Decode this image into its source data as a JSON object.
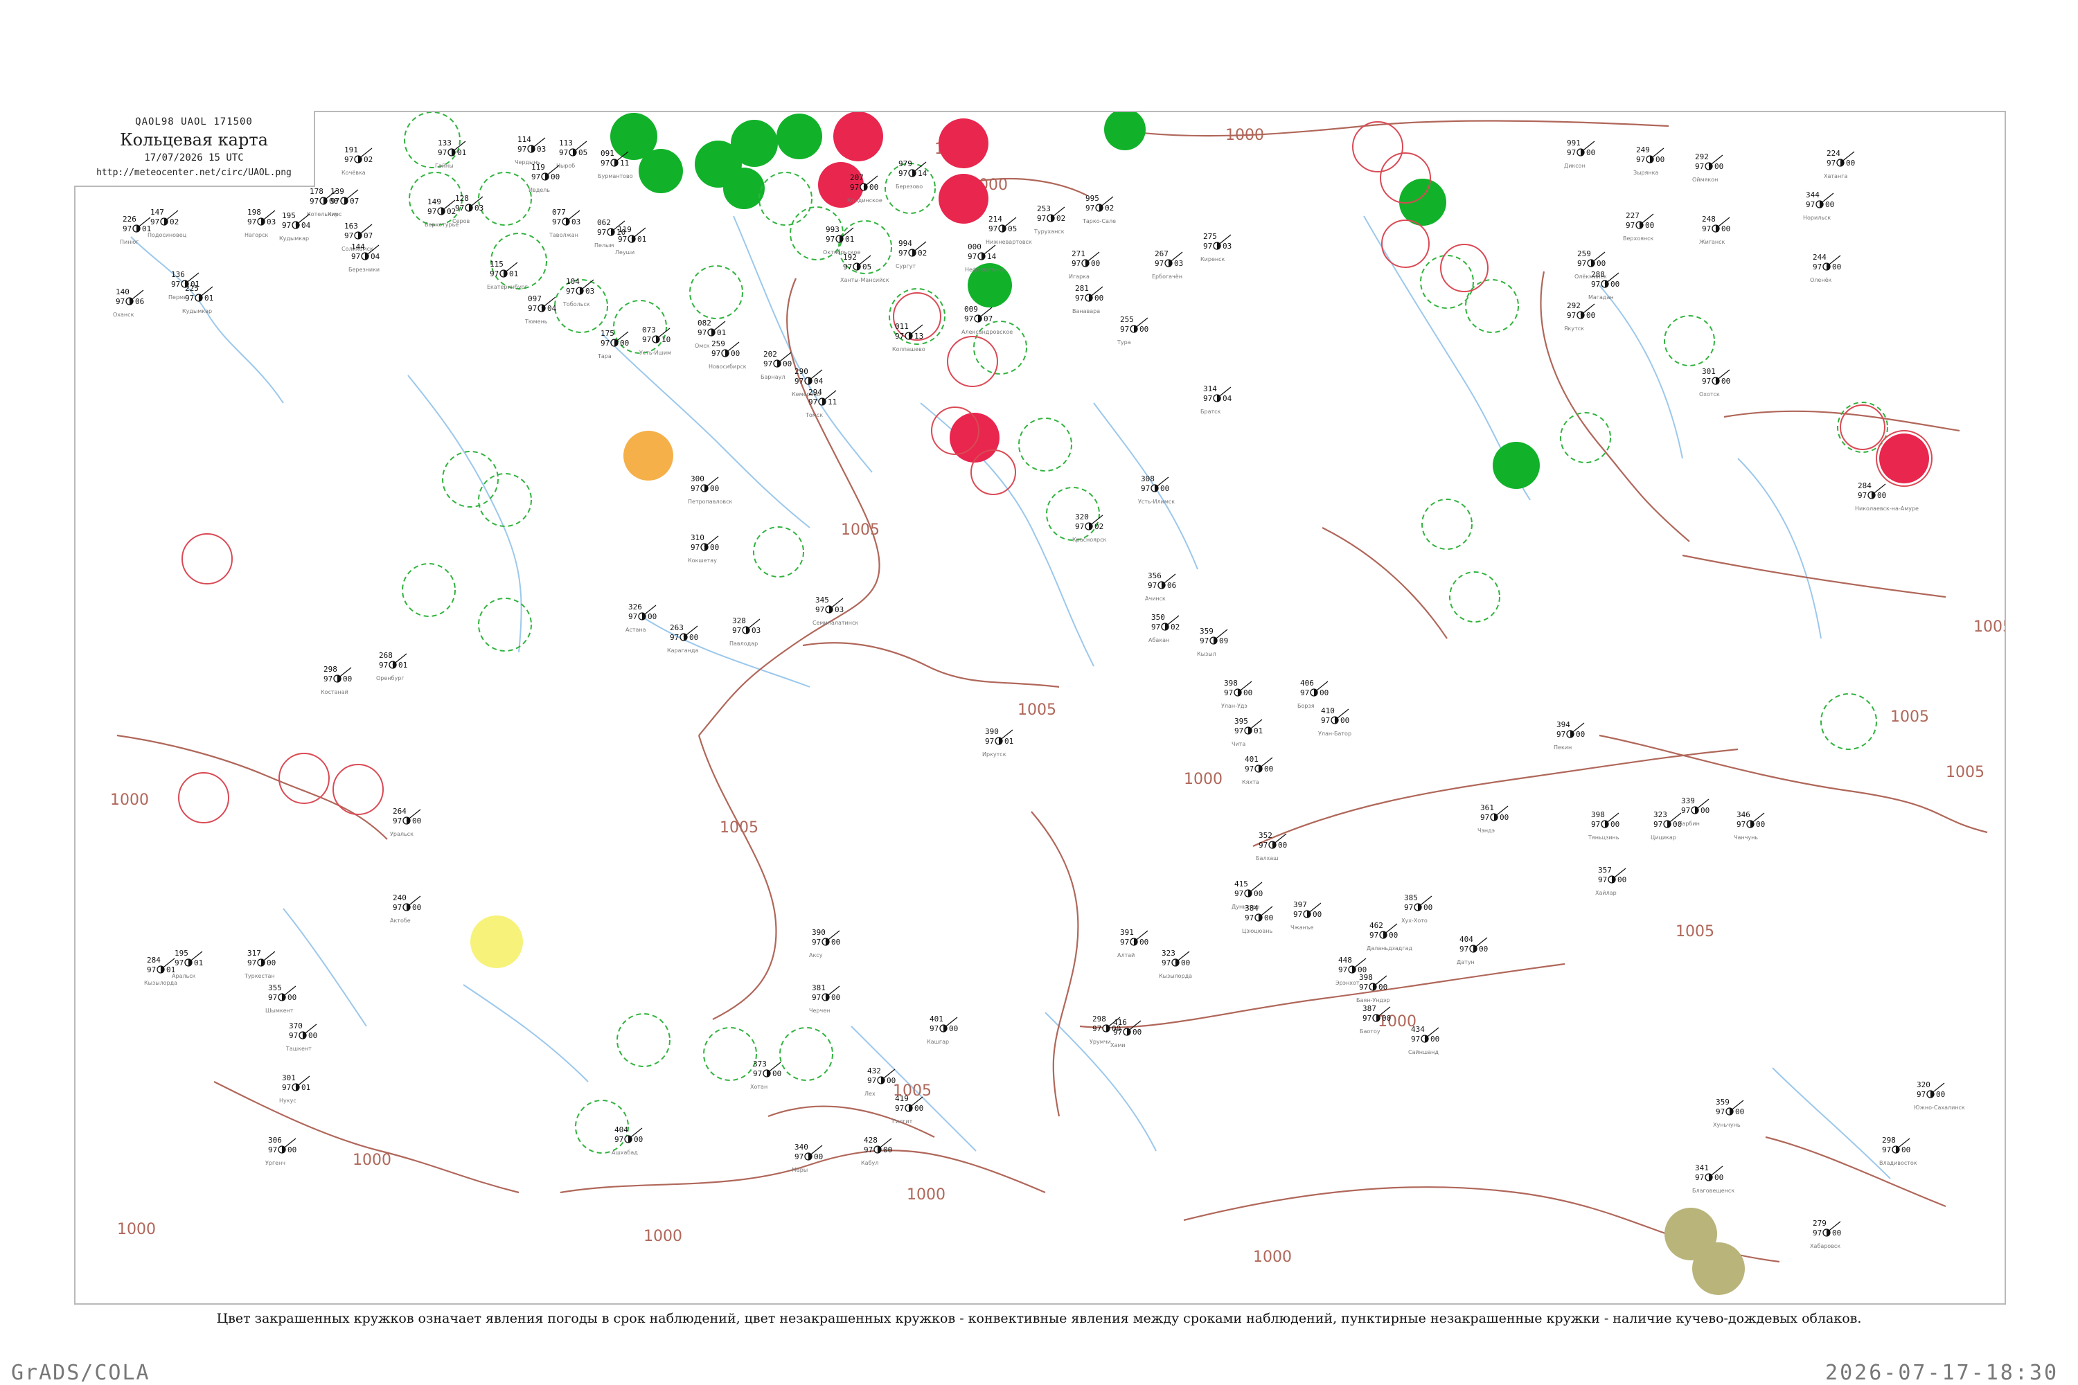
{
  "title": {
    "code": "QAOL98  UAOL  171500",
    "name": "Кольцевая карта",
    "date": "17/07/2026 15 UTC",
    "url": "http://meteocenter.net/circ/UAOL.png"
  },
  "caption": "Цвет закрашенных кружков означает явления погоды в срок наблюдений, цвет незакрашенных кружков - конвективные явления между сроками наблюдений, пунктирные незакрашенные кружки - наличие кучево-дождевых облаков.",
  "footer": {
    "left": "GrADS/COLA",
    "right": "2026-07-17-18:30"
  },
  "colors": {
    "isobar": "#b0675a",
    "river": "#9cc8ec",
    "green_fill": "#11b22a",
    "red_fill": "#e8264e",
    "orange_fill": "#f5b04a",
    "yellow_fill": "#f7f27a",
    "olive_fill": "#b9b47a",
    "cb_dashed": "#31b33e",
    "convective_red": "#d94a55",
    "frame": "#b9b9b9"
  },
  "isobar_labels": [
    "1000",
    "1000",
    "1000",
    "1000",
    "1000",
    "1000",
    "1000",
    "1000",
    "1005",
    "1005",
    "1005",
    "1005",
    "1005",
    "1005",
    "1005",
    "1005",
    "1000",
    "1000",
    "1000"
  ],
  "stations": [
    {
      "t": "191",
      "p": "97",
      "q": "02",
      "name": "Кочёвка"
    },
    {
      "t": "133",
      "p": "97",
      "q": "01",
      "name": "Гайны"
    },
    {
      "t": "114",
      "p": "97",
      "q": "03",
      "name": "Чердынь"
    },
    {
      "t": "113",
      "p": "97",
      "q": "05",
      "name": "Ныроб"
    },
    {
      "t": "119",
      "p": "97",
      "q": "00",
      "name": "Ивдель"
    },
    {
      "t": "091",
      "p": "97",
      "q": "11",
      "name": "Бурмантово"
    },
    {
      "t": "226",
      "p": "97",
      "q": "01",
      "name": "Пинюг"
    },
    {
      "t": "147",
      "p": "97",
      "q": "02",
      "name": "Подосиновец"
    },
    {
      "t": "178",
      "p": "97",
      "q": "00",
      "name": "Котельнич"
    },
    {
      "t": "139",
      "p": "97",
      "q": "07",
      "name": "Кирс"
    },
    {
      "t": "198",
      "p": "97",
      "q": "03",
      "name": "Нагорск"
    },
    {
      "t": "195",
      "p": "97",
      "q": "04",
      "name": "Кудымкар"
    },
    {
      "t": "163",
      "p": "97",
      "q": "07",
      "name": "Соликамск"
    },
    {
      "t": "144",
      "p": "97",
      "q": "04",
      "name": "Березники"
    },
    {
      "t": "149",
      "p": "97",
      "q": "02",
      "name": "Верхотурье"
    },
    {
      "t": "128",
      "p": "97",
      "q": "03",
      "name": "Серов"
    },
    {
      "t": "062",
      "p": "97",
      "q": "10",
      "name": "Пелым"
    },
    {
      "t": "077",
      "p": "97",
      "q": "03",
      "name": "Таволжан"
    },
    {
      "t": "119",
      "p": "97",
      "q": "01",
      "name": "Леуши"
    },
    {
      "t": "207",
      "p": "97",
      "q": "00",
      "name": "Кондинское"
    },
    {
      "t": "979",
      "p": "97",
      "q": "14",
      "name": "Березово"
    },
    {
      "t": "993",
      "p": "97",
      "q": "01",
      "name": "Октябрьское"
    },
    {
      "t": "192",
      "p": "97",
      "q": "05",
      "name": "Ханты-Мансийск"
    },
    {
      "t": "994",
      "p": "97",
      "q": "02",
      "name": "Сургут"
    },
    {
      "t": "000",
      "p": "97",
      "q": "14",
      "name": "Нефтеюганск"
    },
    {
      "t": "995",
      "p": "97",
      "q": "02",
      "name": "Тарко-Сале"
    },
    {
      "t": "225",
      "p": "97",
      "q": "01",
      "name": "Кудымкар"
    },
    {
      "t": "136",
      "p": "97",
      "q": "01",
      "name": "Пермь"
    },
    {
      "t": "140",
      "p": "97",
      "q": "06",
      "name": "Оханск"
    },
    {
      "t": "115",
      "p": "97",
      "q": "01",
      "name": "Екатеринбург"
    },
    {
      "t": "097",
      "p": "97",
      "q": "04",
      "name": "Тюмень"
    },
    {
      "t": "104",
      "p": "97",
      "q": "03",
      "name": "Тобольск"
    },
    {
      "t": "175",
      "p": "97",
      "q": "00",
      "name": "Тара"
    },
    {
      "t": "073",
      "p": "97",
      "q": "10",
      "name": "Усть-Ишим"
    },
    {
      "t": "082",
      "p": "97",
      "q": "01",
      "name": "Омск"
    },
    {
      "t": "259",
      "p": "97",
      "q": "00",
      "name": "Новосибирск"
    },
    {
      "t": "202",
      "p": "97",
      "q": "00",
      "name": "Барнаул"
    },
    {
      "t": "290",
      "p": "97",
      "q": "04",
      "name": "Кемерово"
    },
    {
      "t": "294",
      "p": "97",
      "q": "11",
      "name": "Томск"
    },
    {
      "t": "011",
      "p": "97",
      "q": "13",
      "name": "Колпашево"
    },
    {
      "t": "009",
      "p": "97",
      "q": "07",
      "name": "Александровское"
    },
    {
      "t": "214",
      "p": "97",
      "q": "05",
      "name": "Нижневартовск"
    },
    {
      "t": "253",
      "p": "97",
      "q": "02",
      "name": "Туруханск"
    },
    {
      "t": "271",
      "p": "97",
      "q": "00",
      "name": "Игарка"
    },
    {
      "t": "281",
      "p": "97",
      "q": "00",
      "name": "Ванавара"
    },
    {
      "t": "255",
      "p": "97",
      "q": "00",
      "name": "Тура"
    },
    {
      "t": "267",
      "p": "97",
      "q": "03",
      "name": "Ербогачён"
    },
    {
      "t": "275",
      "p": "97",
      "q": "03",
      "name": "Киренск"
    },
    {
      "t": "314",
      "p": "97",
      "q": "04",
      "name": "Братск"
    },
    {
      "t": "308",
      "p": "97",
      "q": "00",
      "name": "Усть-Илимск"
    },
    {
      "t": "320",
      "p": "97",
      "q": "02",
      "name": "Красноярск"
    },
    {
      "t": "356",
      "p": "97",
      "q": "06",
      "name": "Ачинск"
    },
    {
      "t": "350",
      "p": "97",
      "q": "02",
      "name": "Абакан"
    },
    {
      "t": "359",
      "p": "97",
      "q": "09",
      "name": "Кызыл"
    },
    {
      "t": "390",
      "p": "97",
      "q": "01",
      "name": "Иркутск"
    },
    {
      "t": "398",
      "p": "97",
      "q": "00",
      "name": "Улан-Удэ"
    },
    {
      "t": "395",
      "p": "97",
      "q": "01",
      "name": "Чита"
    },
    {
      "t": "401",
      "p": "97",
      "q": "00",
      "name": "Кяхта"
    },
    {
      "t": "406",
      "p": "97",
      "q": "00",
      "name": "Борзя"
    },
    {
      "t": "410",
      "p": "97",
      "q": "00",
      "name": "Улан-Батор"
    },
    {
      "t": "345",
      "p": "97",
      "q": "03",
      "name": "Семипалатинск"
    },
    {
      "t": "328",
      "p": "97",
      "q": "03",
      "name": "Павлодар"
    },
    {
      "t": "310",
      "p": "97",
      "q": "00",
      "name": "Кокшетау"
    },
    {
      "t": "300",
      "p": "97",
      "q": "00",
      "name": "Петропавловск"
    },
    {
      "t": "326",
      "p": "97",
      "q": "00",
      "name": "Астана"
    },
    {
      "t": "263",
      "p": "97",
      "q": "00",
      "name": "Караганда"
    },
    {
      "t": "298",
      "p": "97",
      "q": "00",
      "name": "Костанай"
    },
    {
      "t": "268",
      "p": "97",
      "q": "01",
      "name": "Оренбург"
    },
    {
      "t": "264",
      "p": "97",
      "q": "00",
      "name": "Уральск"
    },
    {
      "t": "240",
      "p": "97",
      "q": "00",
      "name": "Актобе"
    },
    {
      "t": "195",
      "p": "97",
      "q": "01",
      "name": "Аральск"
    },
    {
      "t": "284",
      "p": "97",
      "q": "01",
      "name": "Кызылорда"
    },
    {
      "t": "317",
      "p": "97",
      "q": "00",
      "name": "Туркестан"
    },
    {
      "t": "355",
      "p": "97",
      "q": "00",
      "name": "Шымкент"
    },
    {
      "t": "370",
      "p": "97",
      "q": "00",
      "name": "Ташкент"
    },
    {
      "t": "301",
      "p": "97",
      "q": "01",
      "name": "Нукус"
    },
    {
      "t": "306",
      "p": "97",
      "q": "00",
      "name": "Ургенч"
    },
    {
      "t": "404",
      "p": "97",
      "q": "00",
      "name": "Ашхабад"
    },
    {
      "t": "340",
      "p": "97",
      "q": "00",
      "name": "Мары"
    },
    {
      "t": "428",
      "p": "97",
      "q": "00",
      "name": "Кабул"
    },
    {
      "t": "419",
      "p": "97",
      "q": "00",
      "name": "Гилгит"
    },
    {
      "t": "432",
      "p": "97",
      "q": "00",
      "name": "Лех"
    },
    {
      "t": "373",
      "p": "97",
      "q": "00",
      "name": "Хотан"
    },
    {
      "t": "381",
      "p": "97",
      "q": "00",
      "name": "Черчен"
    },
    {
      "t": "401",
      "p": "97",
      "q": "00",
      "name": "Кашгар"
    },
    {
      "t": "390",
      "p": "97",
      "q": "00",
      "name": "Аксу"
    },
    {
      "t": "298",
      "p": "97",
      "q": "00",
      "name": "Урумчи"
    },
    {
      "t": "416",
      "p": "97",
      "q": "00",
      "name": "Хами"
    },
    {
      "t": "391",
      "p": "97",
      "q": "00",
      "name": "Алтай"
    },
    {
      "t": "323",
      "p": "97",
      "q": "00",
      "name": "Кызылорда"
    },
    {
      "t": "352",
      "p": "97",
      "q": "00",
      "name": "Балхаш"
    },
    {
      "t": "415",
      "p": "97",
      "q": "00",
      "name": "Дуньхуан"
    },
    {
      "t": "384",
      "p": "97",
      "q": "00",
      "name": "Цзюцюань"
    },
    {
      "t": "397",
      "p": "97",
      "q": "00",
      "name": "Чжанъе"
    },
    {
      "t": "462",
      "p": "97",
      "q": "00",
      "name": "Даланьдзадгад"
    },
    {
      "t": "398",
      "p": "97",
      "q": "00",
      "name": "Баян-Ундэр"
    },
    {
      "t": "434",
      "p": "97",
      "q": "00",
      "name": "Сайншанд"
    },
    {
      "t": "448",
      "p": "97",
      "q": "00",
      "name": "Эрэнхот"
    },
    {
      "t": "387",
      "p": "97",
      "q": "00",
      "name": "Баотоу"
    },
    {
      "t": "385",
      "p": "97",
      "q": "00",
      "name": "Хух-Хото"
    },
    {
      "t": "404",
      "p": "97",
      "q": "00",
      "name": "Датун"
    },
    {
      "t": "361",
      "p": "97",
      "q": "00",
      "name": "Чэндэ"
    },
    {
      "t": "394",
      "p": "97",
      "q": "00",
      "name": "Пекин"
    },
    {
      "t": "398",
      "p": "97",
      "q": "00",
      "name": "Тяньцзинь"
    },
    {
      "t": "357",
      "p": "97",
      "q": "00",
      "name": "Хайлар"
    },
    {
      "t": "323",
      "p": "97",
      "q": "00",
      "name": "Цицикар"
    },
    {
      "t": "339",
      "p": "97",
      "q": "00",
      "name": "Харбин"
    },
    {
      "t": "346",
      "p": "97",
      "q": "00",
      "name": "Чанчунь"
    },
    {
      "t": "359",
      "p": "97",
      "q": "00",
      "name": "Хуньчунь"
    },
    {
      "t": "341",
      "p": "97",
      "q": "00",
      "name": "Благовещенск"
    },
    {
      "t": "279",
      "p": "97",
      "q": "00",
      "name": "Хабаровск"
    },
    {
      "t": "298",
      "p": "97",
      "q": "00",
      "name": "Владивосток"
    },
    {
      "t": "320",
      "p": "97",
      "q": "00",
      "name": "Южно-Сахалинск"
    },
    {
      "t": "284",
      "p": "97",
      "q": "00",
      "name": "Николаевск-на-Амуре"
    },
    {
      "t": "301",
      "p": "97",
      "q": "00",
      "name": "Охотск"
    },
    {
      "t": "288",
      "p": "97",
      "q": "00",
      "name": "Магадан"
    },
    {
      "t": "292",
      "p": "97",
      "q": "00",
      "name": "Якутск"
    },
    {
      "t": "259",
      "p": "97",
      "q": "00",
      "name": "Олёкминск"
    },
    {
      "t": "227",
      "p": "97",
      "q": "00",
      "name": "Верхоянск"
    },
    {
      "t": "249",
      "p": "97",
      "q": "00",
      "name": "Зырянка"
    },
    {
      "t": "292",
      "p": "97",
      "q": "00",
      "name": "Оймякон"
    },
    {
      "t": "248",
      "p": "97",
      "q": "00",
      "name": "Жиганск"
    },
    {
      "t": "244",
      "p": "97",
      "q": "00",
      "name": "Оленёк"
    },
    {
      "t": "224",
      "p": "97",
      "q": "00",
      "name": "Хатанга"
    },
    {
      "t": "344",
      "p": "97",
      "q": "00",
      "name": "Норильск"
    },
    {
      "t": "991",
      "p": "97",
      "q": "00",
      "name": "Диксон"
    }
  ]
}
